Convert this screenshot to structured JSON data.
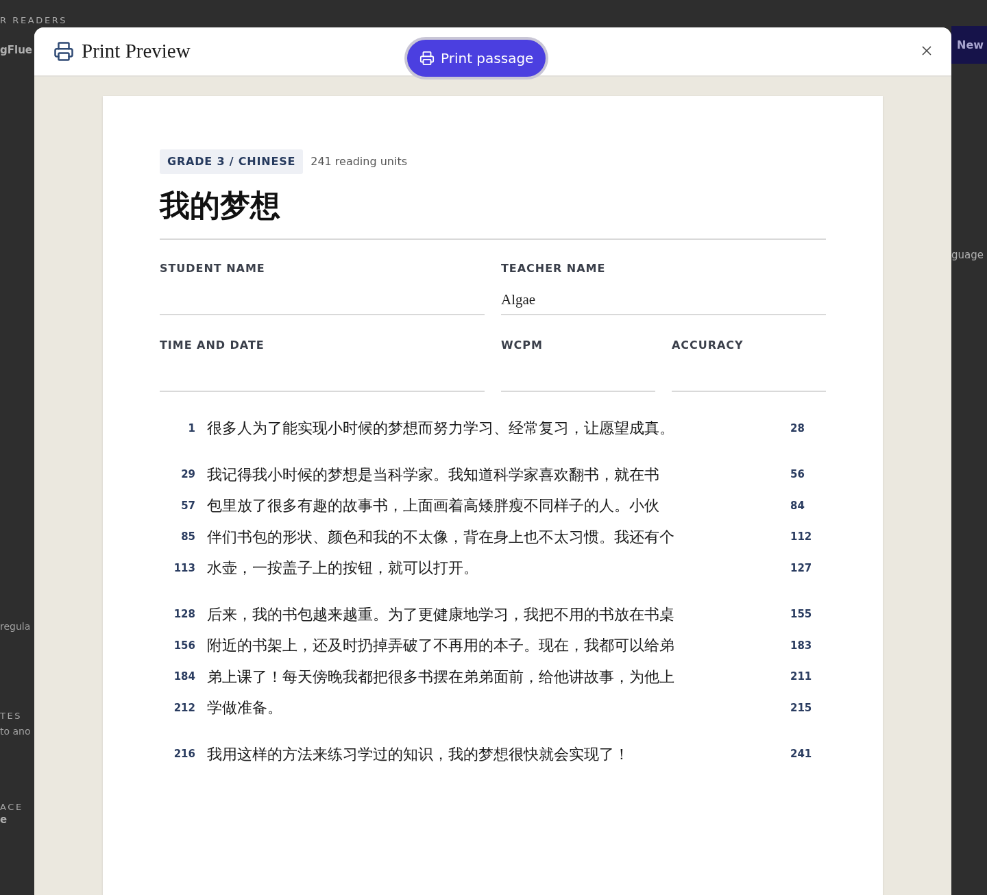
{
  "background": {
    "left_texts": [
      {
        "kind": "eyebrow",
        "text": "R READERS"
      },
      {
        "kind": "heading",
        "text": "gFlue"
      },
      {
        "kind": "body",
        "text": "regula"
      },
      {
        "kind": "eyebrow",
        "text": "TES"
      },
      {
        "kind": "body",
        "text": "to ano"
      },
      {
        "kind": "eyebrow",
        "text": "ACE"
      },
      {
        "kind": "heading",
        "text": "e"
      }
    ],
    "new_button": "New",
    "right_text": "guage"
  },
  "dialog": {
    "title": "Print Preview",
    "print_button": "Print passage"
  },
  "passage": {
    "tag": "GRADE 3 / CHINESE",
    "units": "241 reading units",
    "title": "我的梦想",
    "field_rows": [
      [
        {
          "label": "STUDENT NAME"
        },
        {
          "label": "TEACHER NAME",
          "value": "Algae"
        }
      ],
      [
        {
          "label": "TIME AND DATE"
        },
        {
          "label": "WCPM"
        },
        {
          "label": "ACCURACY"
        }
      ]
    ],
    "paragraphs": [
      [
        {
          "start": "1",
          "text": "很多人为了能实现小时候的梦想而努力学习、经常复习，让愿望成真。",
          "end": "28"
        }
      ],
      [
        {
          "start": "29",
          "text": "我记得我小时候的梦想是当科学家。我知道科学家喜欢翻书，就在书",
          "end": "56"
        },
        {
          "start": "57",
          "text": "包里放了很多有趣的故事书，上面画着高矮胖瘦不同样子的人。小伙",
          "end": "84"
        },
        {
          "start": "85",
          "text": "伴们书包的形状、颜色和我的不太像，背在身上也不太习惯。我还有个",
          "end": "112"
        },
        {
          "start": "113",
          "text": "水壶，一按盖子上的按钮，就可以打开。",
          "end": "127"
        }
      ],
      [
        {
          "start": "128",
          "text": "后来，我的书包越来越重。为了更健康地学习，我把不用的书放在书桌",
          "end": "155"
        },
        {
          "start": "156",
          "text": "附近的书架上，还及时扔掉弄破了不再用的本子。现在，我都可以给弟",
          "end": "183"
        },
        {
          "start": "184",
          "text": "弟上课了！每天傍晚我都把很多书摆在弟弟面前，给他讲故事，为他上",
          "end": "211"
        },
        {
          "start": "212",
          "text": "学做准备。",
          "end": "215"
        }
      ],
      [
        {
          "start": "216",
          "text": "我用这样的方法来练习学过的知识，我的梦想很快就会实现了！",
          "end": "241"
        }
      ]
    ]
  }
}
